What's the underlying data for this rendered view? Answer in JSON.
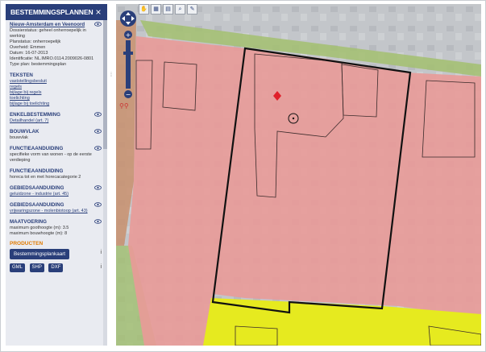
{
  "sidebar": {
    "title": "BESTEMMINGSPLANNEN",
    "close": "×",
    "plan": {
      "name": "Nieuw-Amsterdam en Veenoord",
      "lines": [
        "Dossierstatus: geheel onherroepelijk in",
        "werking",
        "Planstatus: onherroepelijk",
        "Overheid: Emmen",
        "Datum: 16-07-2013",
        "Identificatie: NL.IMRO.0114.2009026-0801",
        "Type plan: bestemmingsplan"
      ]
    },
    "teksten": {
      "title": "TEKSTEN",
      "links": [
        "vaststellingsbesluit",
        "regels",
        "bijlage bij regels",
        "toelichting",
        "bijlage bij toelichting"
      ]
    },
    "sections": [
      {
        "title": "ENKELBESTEMMING",
        "text": "Detailhandel (art. 7)",
        "link": true,
        "eye": true
      },
      {
        "title": "BOUWVLAK",
        "text": "bouwvlak",
        "link": false,
        "eye": true
      },
      {
        "title": "FUNCTIEAANDUIDING",
        "text": "specifieke vorm van wonen - op de eerste verdieping",
        "link": false,
        "eye": true
      },
      {
        "title": "FUNCTIEAANDUIDING",
        "text": "horeca tot en met horecacategorie 2",
        "link": false,
        "eye": false
      },
      {
        "title": "GEBIEDSAANDUIDING",
        "text": "geluidzone - industrie (art. 45)",
        "link": true,
        "eye": true
      },
      {
        "title": "GEBIEDSAANDUIDING",
        "text": "vrijwaringszone - molenbiotoop (art. 43)",
        "link": true,
        "eye": true
      },
      {
        "title": "MAATVOERING",
        "text": "maximum goothoogte (m): 3.5\nmaximum bouwhoogte (m): 8",
        "link": false,
        "eye": true
      }
    ],
    "producten": {
      "title": "PRODUCTEN",
      "main_button": "Bestemmingsplankaart",
      "info": "i",
      "formats": [
        "GML",
        "SHP",
        "DXF"
      ]
    }
  },
  "toolbar": {
    "icons": [
      "hand-icon",
      "measure-icon",
      "ruler-icon",
      "zoom-icon",
      "pin-icon"
    ]
  },
  "colors": {
    "header": "#2a3f7a",
    "detailhandel": "#e99a98",
    "yellow": "#e6ea1f",
    "green": "#a3c070",
    "orange": "#e07a00"
  }
}
